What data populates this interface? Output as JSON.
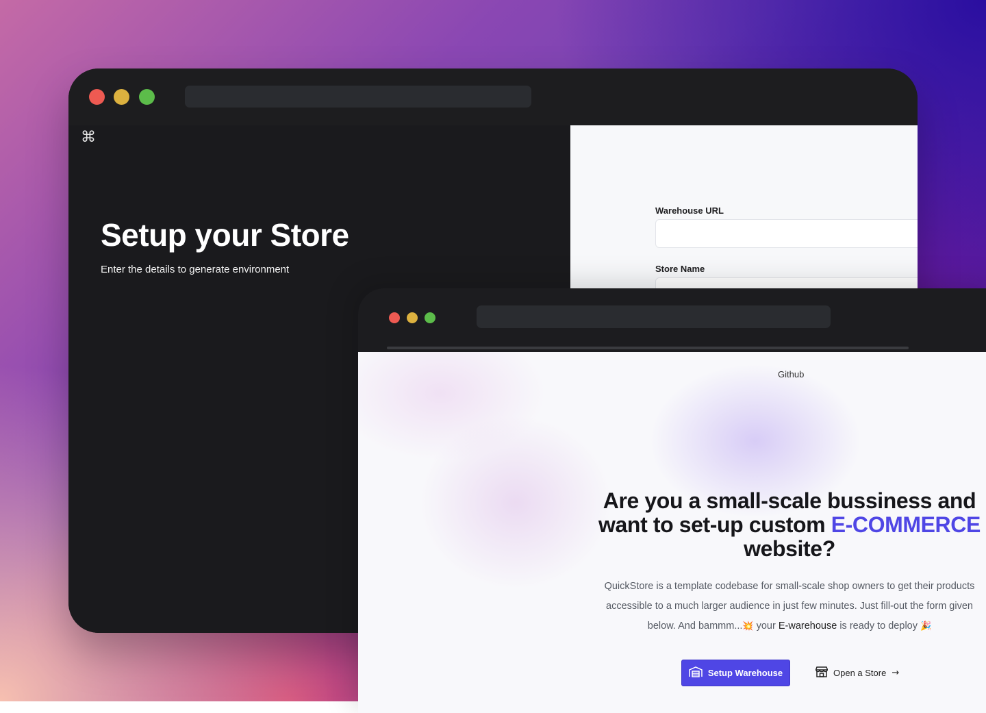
{
  "back_window": {
    "command_glyph": "⌘",
    "title": "Setup your Store",
    "subtitle": "Enter the details to generate environment",
    "form": {
      "warehouse_url_label": "Warehouse URL",
      "store_name_label": "Store Name"
    }
  },
  "front_window": {
    "nav": {
      "github": "Github"
    },
    "hero": {
      "title_part1": "Are you a small-scale bussiness and want to set-up custom ",
      "title_accent": "E-COMMERCE",
      "title_part2": " website?",
      "desc_part1": "QuickStore is a template codebase for small-scale shop owners to get their products accessible to a much larger audience in just few minutes. Just fill-out the form given below. And bammm...",
      "desc_emoji1": "💥",
      "desc_part2": " your ",
      "desc_dark": "E-warehouse",
      "desc_part3": " is ready to deploy ",
      "desc_emoji2": "🎉"
    },
    "buttons": {
      "setup_warehouse": "Setup Warehouse",
      "open_store": "Open a Store",
      "arrow": "→"
    }
  },
  "colors": {
    "accent": "#4f46e5",
    "dark_panel": "#1c1c1f",
    "dot_red": "#ee5a52",
    "dot_yellow": "#dcb13f",
    "dot_green": "#5cbc4a"
  }
}
